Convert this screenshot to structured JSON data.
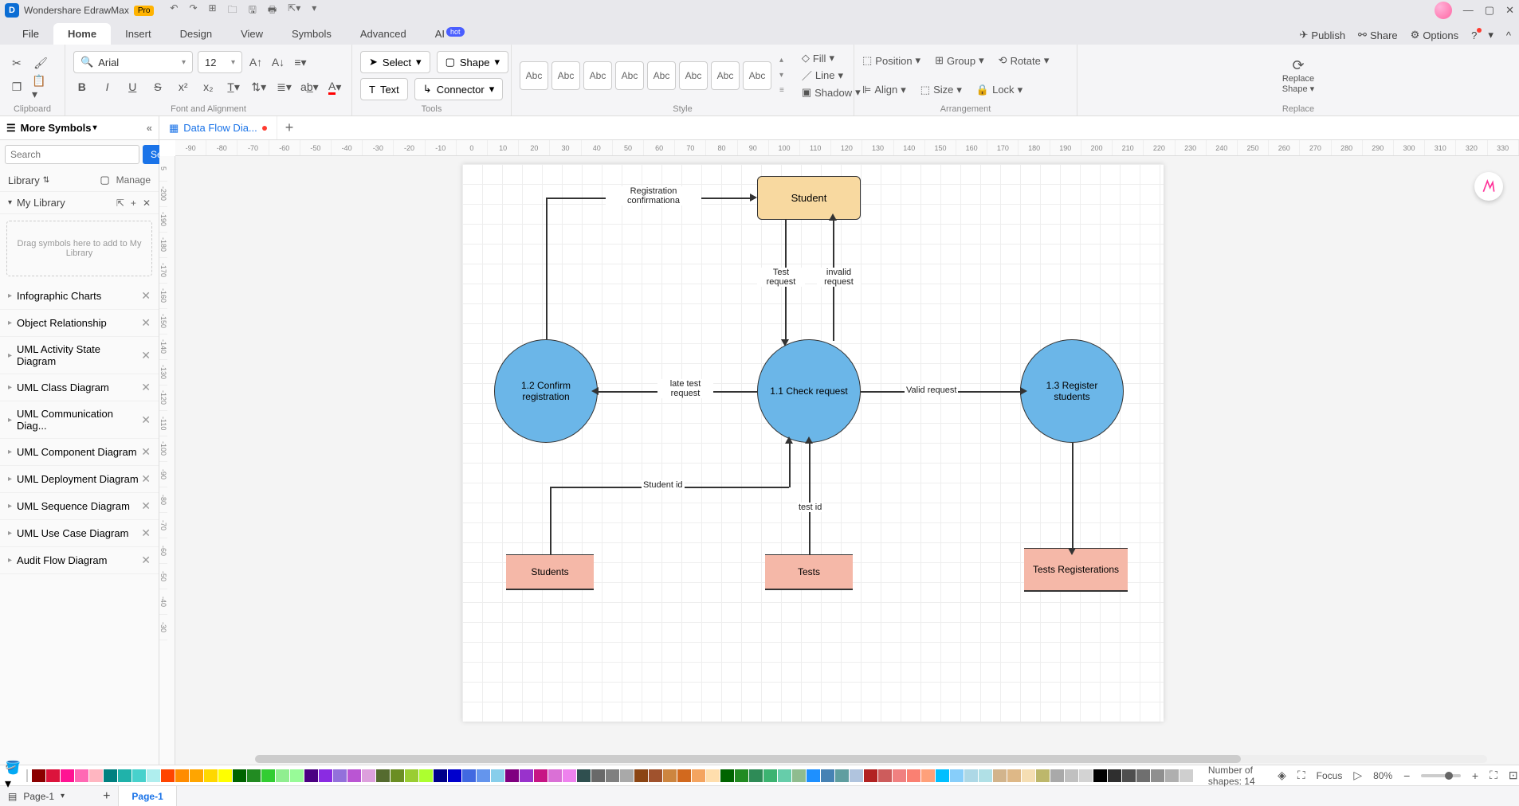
{
  "app": {
    "title": "Wondershare EdrawMax",
    "pro": "Pro"
  },
  "menu": {
    "file": "File",
    "home": "Home",
    "insert": "Insert",
    "design": "Design",
    "view": "View",
    "symbols": "Symbols",
    "advanced": "Advanced",
    "ai": "AI",
    "hot": "hot",
    "publish": "Publish",
    "share": "Share",
    "options": "Options"
  },
  "ribbon": {
    "font": "Arial",
    "size": "12",
    "select": "Select",
    "shape": "Shape",
    "text": "Text",
    "connector": "Connector",
    "abc": "Abc",
    "fill": "Fill",
    "line": "Line",
    "shadow": "Shadow",
    "position": "Position",
    "group": "Group",
    "rotate": "Rotate",
    "align": "Align",
    "sizeL": "Size",
    "lock": "Lock",
    "replace1": "Replace",
    "replace2": "Shape",
    "g_clipboard": "Clipboard",
    "g_font": "Font and Alignment",
    "g_tools": "Tools",
    "g_style": "Style",
    "g_arr": "Arrangement",
    "g_replace": "Replace"
  },
  "doctab": {
    "name": "Data Flow Dia..."
  },
  "left": {
    "more": "More Symbols",
    "search_ph": "Search",
    "search_btn": "Search",
    "library": "Library",
    "manage": "Manage",
    "mylib": "My Library",
    "drop": "Drag symbols here to add to My Library",
    "items": [
      "Infographic Charts",
      "Object Relationship",
      "UML Activity State Diagram",
      "UML Class Diagram",
      "UML Communication Diag...",
      "UML Component Diagram",
      "UML Deployment Diagram",
      "UML Sequence Diagram",
      "UML Use Case Diagram",
      "Audit Flow Diagram"
    ]
  },
  "ruler_h": [
    "-90",
    "-80",
    "-70",
    "-60",
    "-50",
    "-40",
    "-30",
    "-20",
    "-10",
    "0",
    "10",
    "20",
    "30",
    "40",
    "50",
    "60",
    "70",
    "80",
    "90",
    "100",
    "110",
    "120",
    "130",
    "140",
    "150",
    "160",
    "170",
    "180",
    "190",
    "200",
    "210",
    "220",
    "230",
    "240",
    "250",
    "260",
    "270",
    "280",
    "290",
    "300",
    "310",
    "320",
    "330"
  ],
  "ruler_v": [
    "5",
    "-200",
    "-190",
    "-180",
    "-170",
    "-160",
    "-150",
    "-140",
    "-130",
    "-120",
    "-110",
    "-100",
    "-90",
    "-80",
    "-70",
    "-60",
    "-50",
    "-40",
    "-30"
  ],
  "diagram": {
    "student": "Student",
    "p11": "1.1 Check request",
    "p12": "1.2 Confirm registration",
    "p13": "1.3 Register students",
    "students": "Students",
    "tests": "Tests",
    "testsreg": "Tests Registerations",
    "l_reg": "Registration confirmationa",
    "l_testreq": "Test request",
    "l_invalid": "invalid request",
    "l_late": "late test request",
    "l_valid": "Valid request",
    "l_sid": "Student id",
    "l_tid": "test id"
  },
  "palette": [
    "#8b0000",
    "#dc143c",
    "#ff1493",
    "#ff69b4",
    "#ffb6c1",
    "#008080",
    "#20b2aa",
    "#48d1cc",
    "#afeeee",
    "#ff4500",
    "#ff8c00",
    "#ffa500",
    "#ffd700",
    "#ffff00",
    "#006400",
    "#228b22",
    "#32cd32",
    "#90ee90",
    "#98fb98",
    "#4b0082",
    "#8a2be2",
    "#9370db",
    "#ba55d3",
    "#dda0dd",
    "#556b2f",
    "#6b8e23",
    "#9acd32",
    "#adff2f",
    "#00008b",
    "#0000cd",
    "#4169e1",
    "#6495ed",
    "#87ceeb",
    "#800080",
    "#9932cc",
    "#c71585",
    "#da70d6",
    "#ee82ee",
    "#2f4f4f",
    "#696969",
    "#808080",
    "#a9a9a9",
    "#8b4513",
    "#a0522d",
    "#cd853f",
    "#d2691e",
    "#f4a460",
    "#ffdead",
    "#006400",
    "#228b22",
    "#2e8b57",
    "#3cb371",
    "#66cdaa",
    "#8fbc8f",
    "#1e90ff",
    "#4682b4",
    "#5f9ea0",
    "#b0c4de",
    "#b22222",
    "#cd5c5c",
    "#f08080",
    "#fa8072",
    "#ffa07a",
    "#00bfff",
    "#87cefa",
    "#add8e6",
    "#b0e0e6",
    "#d2b48c",
    "#deb887",
    "#f5deb3",
    "#bdb76b",
    "#a9a9a9",
    "#c0c0c0",
    "#d3d3d3",
    "#000000",
    "#2f2f2f",
    "#4f4f4f",
    "#6f6f6f",
    "#8f8f8f",
    "#afafaf",
    "#cfcfcf",
    "#ffffff"
  ],
  "status": {
    "shapes": "Number of shapes: 14",
    "focus": "Focus",
    "zoom": "80%"
  },
  "pagebar": {
    "sel": "Page-1",
    "tab": "Page-1"
  }
}
